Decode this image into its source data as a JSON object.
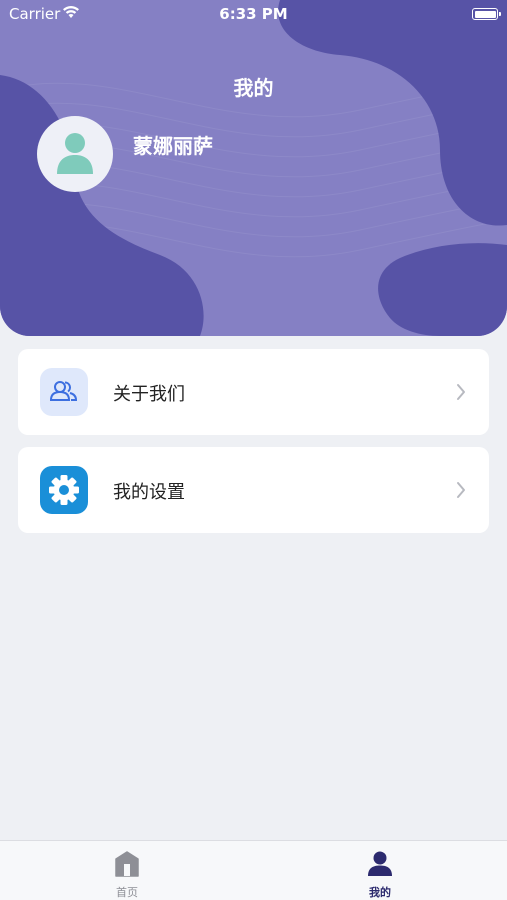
{
  "status_bar": {
    "carrier": "Carrier",
    "time": "6:33 PM"
  },
  "header": {
    "title": "我的",
    "username": "蒙娜丽萨"
  },
  "menu": [
    {
      "label": "关于我们",
      "icon": "users-icon"
    },
    {
      "label": "我的设置",
      "icon": "gear-icon"
    }
  ],
  "tabbar": {
    "items": [
      {
        "label": "首页",
        "icon": "home-icon",
        "active": false
      },
      {
        "label": "我的",
        "icon": "person-icon",
        "active": true
      }
    ]
  },
  "colors": {
    "header_bg": "#8580c4",
    "header_blob": "#5753a6",
    "accent": "#2c2a6e",
    "avatar_figure": "#7fcbbb",
    "settings_icon_bg": "#1a8fd8"
  }
}
